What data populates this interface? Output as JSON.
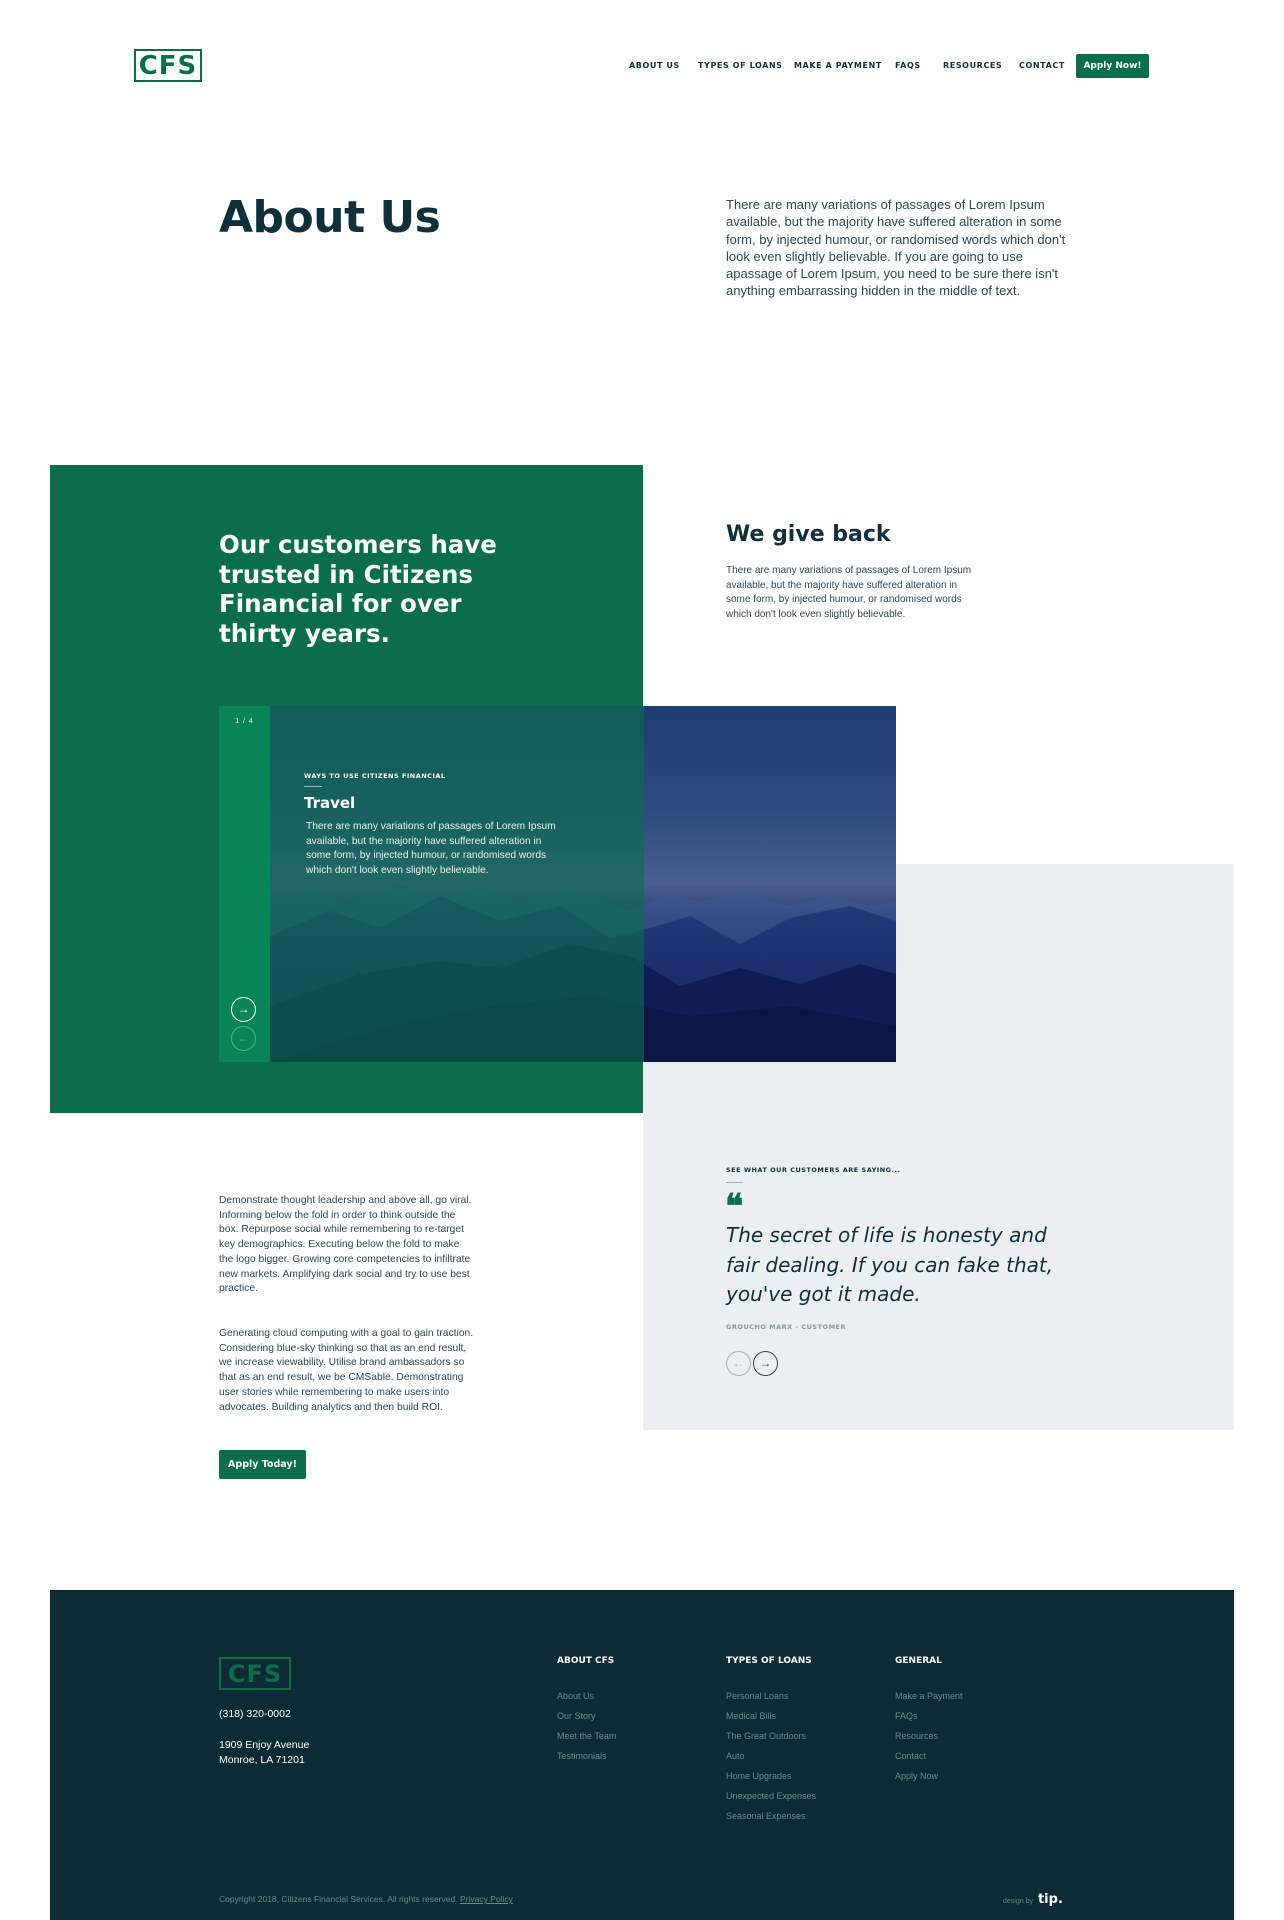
{
  "header": {
    "logo": "CFS",
    "nav": [
      {
        "label": "ABOUT US"
      },
      {
        "label": "TYPES OF LOANS"
      },
      {
        "label": "MAKE A PAYMENT"
      },
      {
        "label": "FAQS"
      },
      {
        "label": "RESOURCES"
      },
      {
        "label": "CONTACT"
      }
    ],
    "cta": "Apply Now!"
  },
  "hero": {
    "title": "About Us",
    "text": "There are many variations of passages of Lorem Ipsum available, but the majority have suffered alteration in some form, by injected humour, or randomised words which don't look even slightly believable. If you are going to use apassage of Lorem Ipsum, you need to be sure there isn't anything embarrassing hidden in the middle of text."
  },
  "trust": {
    "heading": "Our customers have trusted in Citizens Financial for over thirty years."
  },
  "give_back": {
    "title": "We give back",
    "text": "There are many variations of passages of Lorem Ipsum available, but the majority have suffered alteration in some form, by injected humour, or randomised words which don't look even slightly believable."
  },
  "slider": {
    "counter": "1 / 4",
    "kicker": "WAYS TO USE CITIZENS FINANCIAL",
    "title": "Travel",
    "text": "There are many variations of passages of Lorem Ipsum available, but the majority have suffered alteration in some form, by injected humour, or randomised words which don't look even slightly believable.",
    "next_icon": "→",
    "prev_icon": "←"
  },
  "body_copy": {
    "p1": "Demonstrate thought leadership and above all, go viral. Informing below the fold in order to think outside the box. Repurpose social while remembering to re-target key demographics. Executing below the fold to make the logo bigger. Growing core competencies to infiltrate new markets. Amplifying dark social and try to use best practice.",
    "p2": "Generating cloud computing with a goal to gain traction. Considering blue-sky thinking so that as an end result, we increase viewability. Utilise brand ambassadors so that as an end result, we be CMSable. Demonstrating user stories while remembering to make users into advocates. Building analytics and then build ROI.",
    "cta": "Apply Today!"
  },
  "testimonial": {
    "kicker": "SEE WHAT OUR CUSTOMERS ARE SAYING...",
    "quote_mark": "❝",
    "quote": "The secret of life is honesty and fair dealing. If you can fake that, you've got it made.",
    "author": "GROUCHO MARX - CUSTOMER",
    "prev_icon": "←",
    "next_icon": "→"
  },
  "footer": {
    "logo": "CFS",
    "phone": "(318) 320-0002",
    "address_line1": "1909 Enjoy Avenue",
    "address_line2": "Monroe, LA 71201",
    "columns": [
      {
        "title": "ABOUT CFS",
        "links": [
          "About Us",
          "Our Story",
          "Meet the Team",
          "Testimonials"
        ]
      },
      {
        "title": "TYPES OF LOANS",
        "links": [
          "Personal Loans",
          "Medical Bills",
          "The Great Outdoors",
          "Auto",
          "Home Upgrades",
          "Unexpected Expenses",
          "Seasonal Expenses"
        ]
      },
      {
        "title": "GENERAL",
        "links": [
          "Make a Payment",
          "FAQs",
          "Resources",
          "Contact",
          "Apply Now"
        ]
      }
    ],
    "copyright": "Copyright 2018, Citizens Financial Services. All rights reserved.",
    "privacy": "Privacy Policy",
    "design_by": "design by",
    "designer": "tip."
  },
  "colors": {
    "brand_green": "#0a6e4c",
    "navy": "#0f2f3a",
    "footer_bg": "#0d2b35",
    "gray_panel": "#eceef0"
  }
}
